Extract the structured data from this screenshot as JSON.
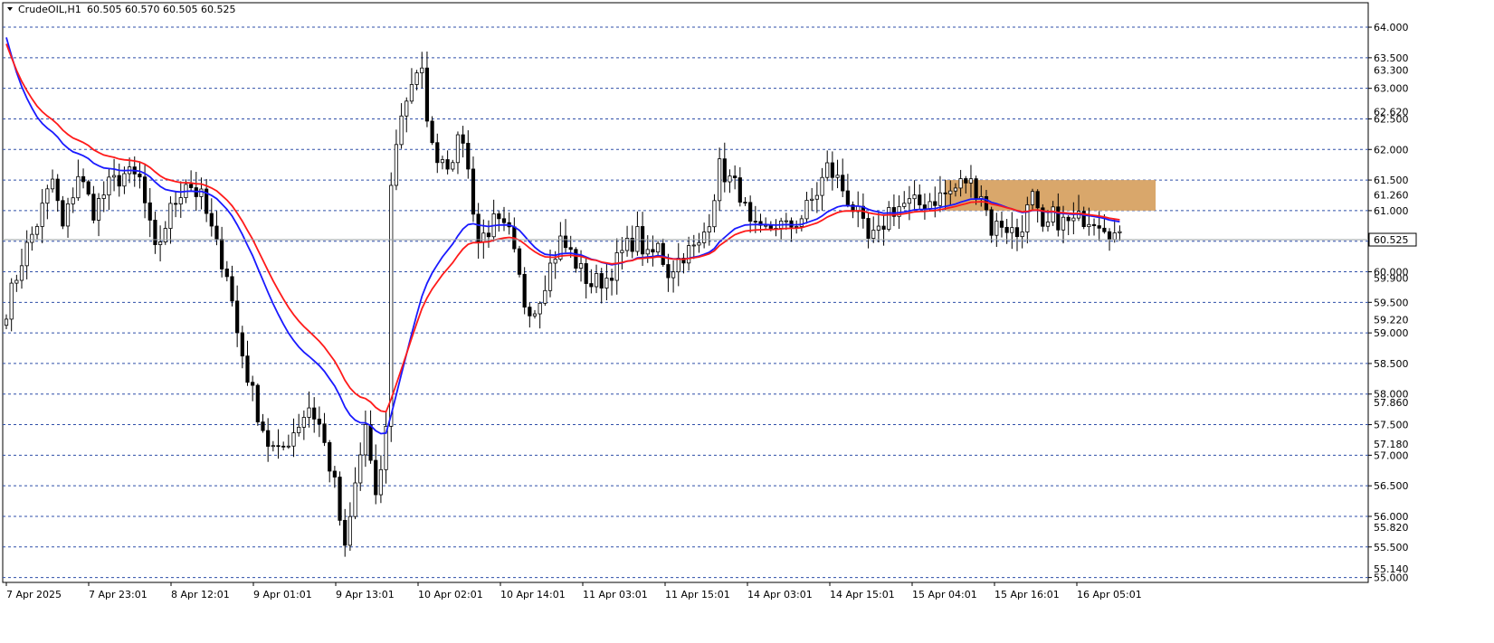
{
  "header": {
    "symbol": "CrudeOIL,H1",
    "ohlc": "60.505 60.570 60.505 60.525"
  },
  "colors": {
    "grid": "#2f4fa8",
    "ma_fast": "#1a1aff",
    "ma_slow": "#ff1a1a",
    "zone": "#d9a76b",
    "label_box": "#ffffff"
  },
  "chart_data": {
    "type": "candlestick",
    "y_range": [
      54.92,
      64.4
    ],
    "grid": true,
    "y_ticks": [
      "64.000",
      "63.500",
      "63.000",
      "62.500",
      "62.000",
      "61.500",
      "61.000",
      "60.500",
      "60.000",
      "59.500",
      "59.000",
      "58.500",
      "58.000",
      "57.500",
      "57.000",
      "56.500",
      "56.000",
      "55.500",
      "55.000"
    ],
    "y_marks": [
      "63.300",
      "62.620",
      "61.260",
      "59.900",
      "59.220",
      "57.860",
      "57.180",
      "55.820",
      "55.140"
    ],
    "current_price": "60.525",
    "x_labels": [
      "7 Apr 2025",
      "7 Apr 23:01",
      "8 Apr 12:01",
      "9 Apr 01:01",
      "9 Apr 13:01",
      "10 Apr 02:01",
      "10 Apr 14:01",
      "11 Apr 03:01",
      "11 Apr 15:01",
      "14 Apr 03:01",
      "14 Apr 15:01",
      "15 Apr 04:01",
      "15 Apr 16:01",
      "16 Apr 05:01"
    ],
    "zone": {
      "from_bar": 183,
      "to_bar": 224,
      "low": 61.0,
      "high": 61.5
    },
    "anchors": [
      [
        0,
        59.4
      ],
      [
        3,
        60.2
      ],
      [
        6,
        60.8
      ],
      [
        9,
        61.5
      ],
      [
        11,
        60.7
      ],
      [
        14,
        61.6
      ],
      [
        17,
        61.0
      ],
      [
        20,
        61.4
      ],
      [
        23,
        61.6
      ],
      [
        26,
        61.5
      ],
      [
        29,
        60.3
      ],
      [
        32,
        61.0
      ],
      [
        35,
        61.5
      ],
      [
        38,
        61.2
      ],
      [
        41,
        60.4
      ],
      [
        43,
        60.0
      ],
      [
        45,
        59.0
      ],
      [
        47,
        58.3
      ],
      [
        49,
        57.7
      ],
      [
        51,
        57.2
      ],
      [
        53,
        57.0
      ],
      [
        56,
        57.4
      ],
      [
        59,
        57.8
      ],
      [
        61,
        57.5
      ],
      [
        64,
        56.5
      ],
      [
        66,
        55.4
      ],
      [
        68,
        56.5
      ],
      [
        70,
        57.5
      ],
      [
        72,
        56.2
      ],
      [
        74,
        57.4
      ],
      [
        75,
        61.5
      ],
      [
        77,
        62.6
      ],
      [
        79,
        63.1
      ],
      [
        81,
        63.2
      ],
      [
        83,
        62.0
      ],
      [
        86,
        61.8
      ],
      [
        89,
        62.2
      ],
      [
        92,
        60.5
      ],
      [
        95,
        60.8
      ],
      [
        98,
        60.6
      ],
      [
        101,
        59.5
      ],
      [
        103,
        59.4
      ],
      [
        106,
        60.1
      ],
      [
        108,
        60.5
      ],
      [
        110,
        60.3
      ],
      [
        112,
        60.0
      ],
      [
        114,
        59.8
      ],
      [
        117,
        59.9
      ],
      [
        120,
        60.3
      ],
      [
        123,
        60.6
      ],
      [
        125,
        60.2
      ],
      [
        127,
        60.4
      ],
      [
        129,
        60.0
      ],
      [
        132,
        60.3
      ],
      [
        135,
        60.4
      ],
      [
        137,
        60.9
      ],
      [
        139,
        61.7
      ],
      [
        141,
        61.5
      ],
      [
        143,
        61.3
      ],
      [
        145,
        60.7
      ],
      [
        147,
        60.6
      ],
      [
        150,
        60.8
      ],
      [
        152,
        60.7
      ],
      [
        155,
        60.9
      ],
      [
        158,
        61.3
      ],
      [
        160,
        61.7
      ],
      [
        162,
        61.5
      ],
      [
        164,
        61.2
      ],
      [
        166,
        60.9
      ],
      [
        168,
        60.5
      ],
      [
        170,
        60.6
      ],
      [
        172,
        61.0
      ],
      [
        175,
        61.1
      ],
      [
        178,
        61.1
      ],
      [
        181,
        61.2
      ],
      [
        184,
        61.3
      ],
      [
        187,
        61.5
      ],
      [
        190,
        61.3
      ],
      [
        192,
        60.7
      ],
      [
        194,
        60.8
      ],
      [
        197,
        60.6
      ],
      [
        200,
        61.2
      ],
      [
        202,
        60.6
      ],
      [
        204,
        60.9
      ],
      [
        206,
        60.8
      ],
      [
        208,
        60.8
      ],
      [
        210,
        60.9
      ],
      [
        212,
        60.9
      ],
      [
        214,
        60.8
      ],
      [
        216,
        60.6
      ],
      [
        217,
        60.5
      ]
    ]
  }
}
